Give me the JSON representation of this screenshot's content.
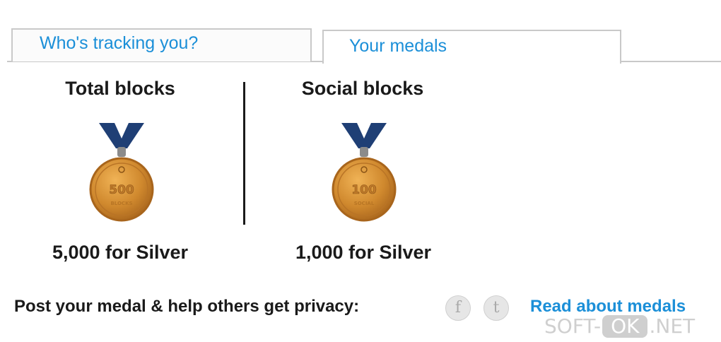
{
  "tabs": [
    {
      "label": "Who's tracking you?",
      "active": false
    },
    {
      "label": "Your medals",
      "active": true
    }
  ],
  "medals": [
    {
      "title": "Total blocks",
      "medal_text": "500",
      "medal_subtext": "BLOCKS",
      "goal": "5,000 for Silver"
    },
    {
      "title": "Social blocks",
      "medal_text": "100",
      "medal_subtext": "SOCIAL",
      "goal": "1,000 for Silver"
    }
  ],
  "footer": {
    "post_text": "Post your medal & help others get privacy:",
    "facebook_glyph": "f",
    "twitter_glyph": "t",
    "read_link": "Read about medals"
  },
  "watermark": {
    "left": "SOFT-",
    "box": "OK",
    "right": ".NET"
  },
  "colors": {
    "link": "#1b8fd8",
    "ribbon": "#1f3f75",
    "bronze": "#d0892e",
    "bronze_dark": "#a8651c",
    "tab_border": "#c9c9c9"
  }
}
